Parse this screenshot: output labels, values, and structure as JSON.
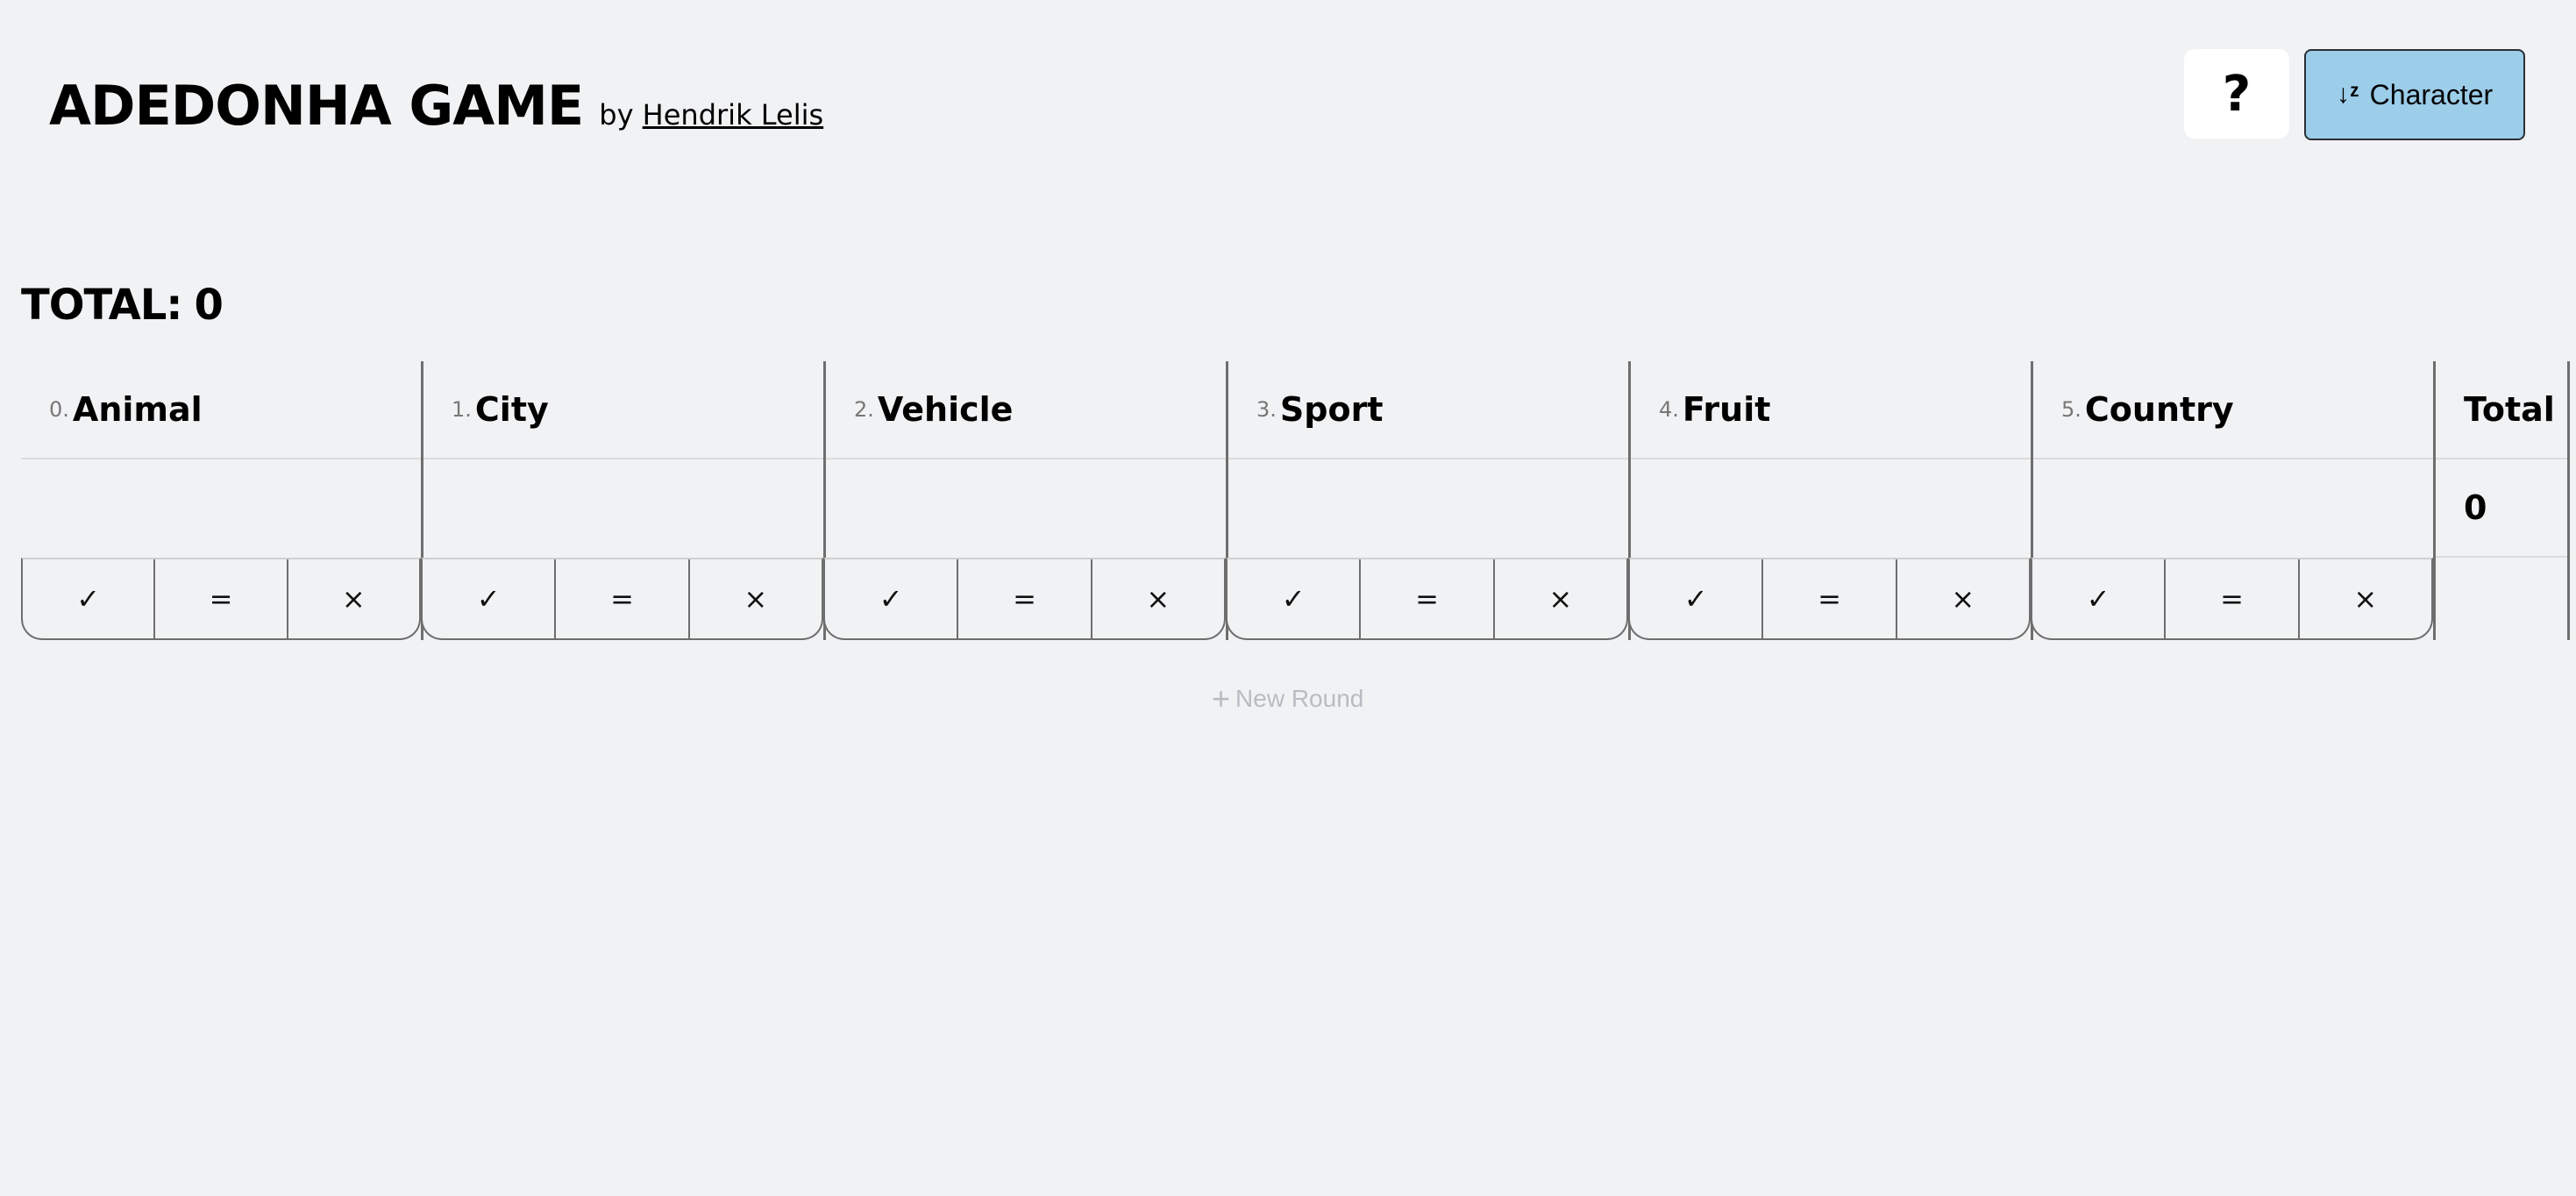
{
  "header": {
    "title": "ADEDONHA GAME",
    "by_label": "by",
    "author": "Hendrik Lelis"
  },
  "toolbar": {
    "help_label": "?",
    "sort_icon": "sort-alpha-icon",
    "sort_label": "Character"
  },
  "summary": {
    "total_label": "TOTAL:",
    "total_value": "0"
  },
  "categories": [
    {
      "num": "0.",
      "name": "Animal"
    },
    {
      "num": "1.",
      "name": "City"
    },
    {
      "num": "2.",
      "name": "Vehicle"
    },
    {
      "num": "3.",
      "name": "Sport"
    },
    {
      "num": "4.",
      "name": "Fruit"
    },
    {
      "num": "5.",
      "name": "Country"
    }
  ],
  "score_buttons": {
    "correct": "✓",
    "equal": "=",
    "wrong": "×"
  },
  "total_column": {
    "header": "Total",
    "value": "0"
  },
  "new_round": {
    "icon": "+",
    "label": "New Round"
  }
}
